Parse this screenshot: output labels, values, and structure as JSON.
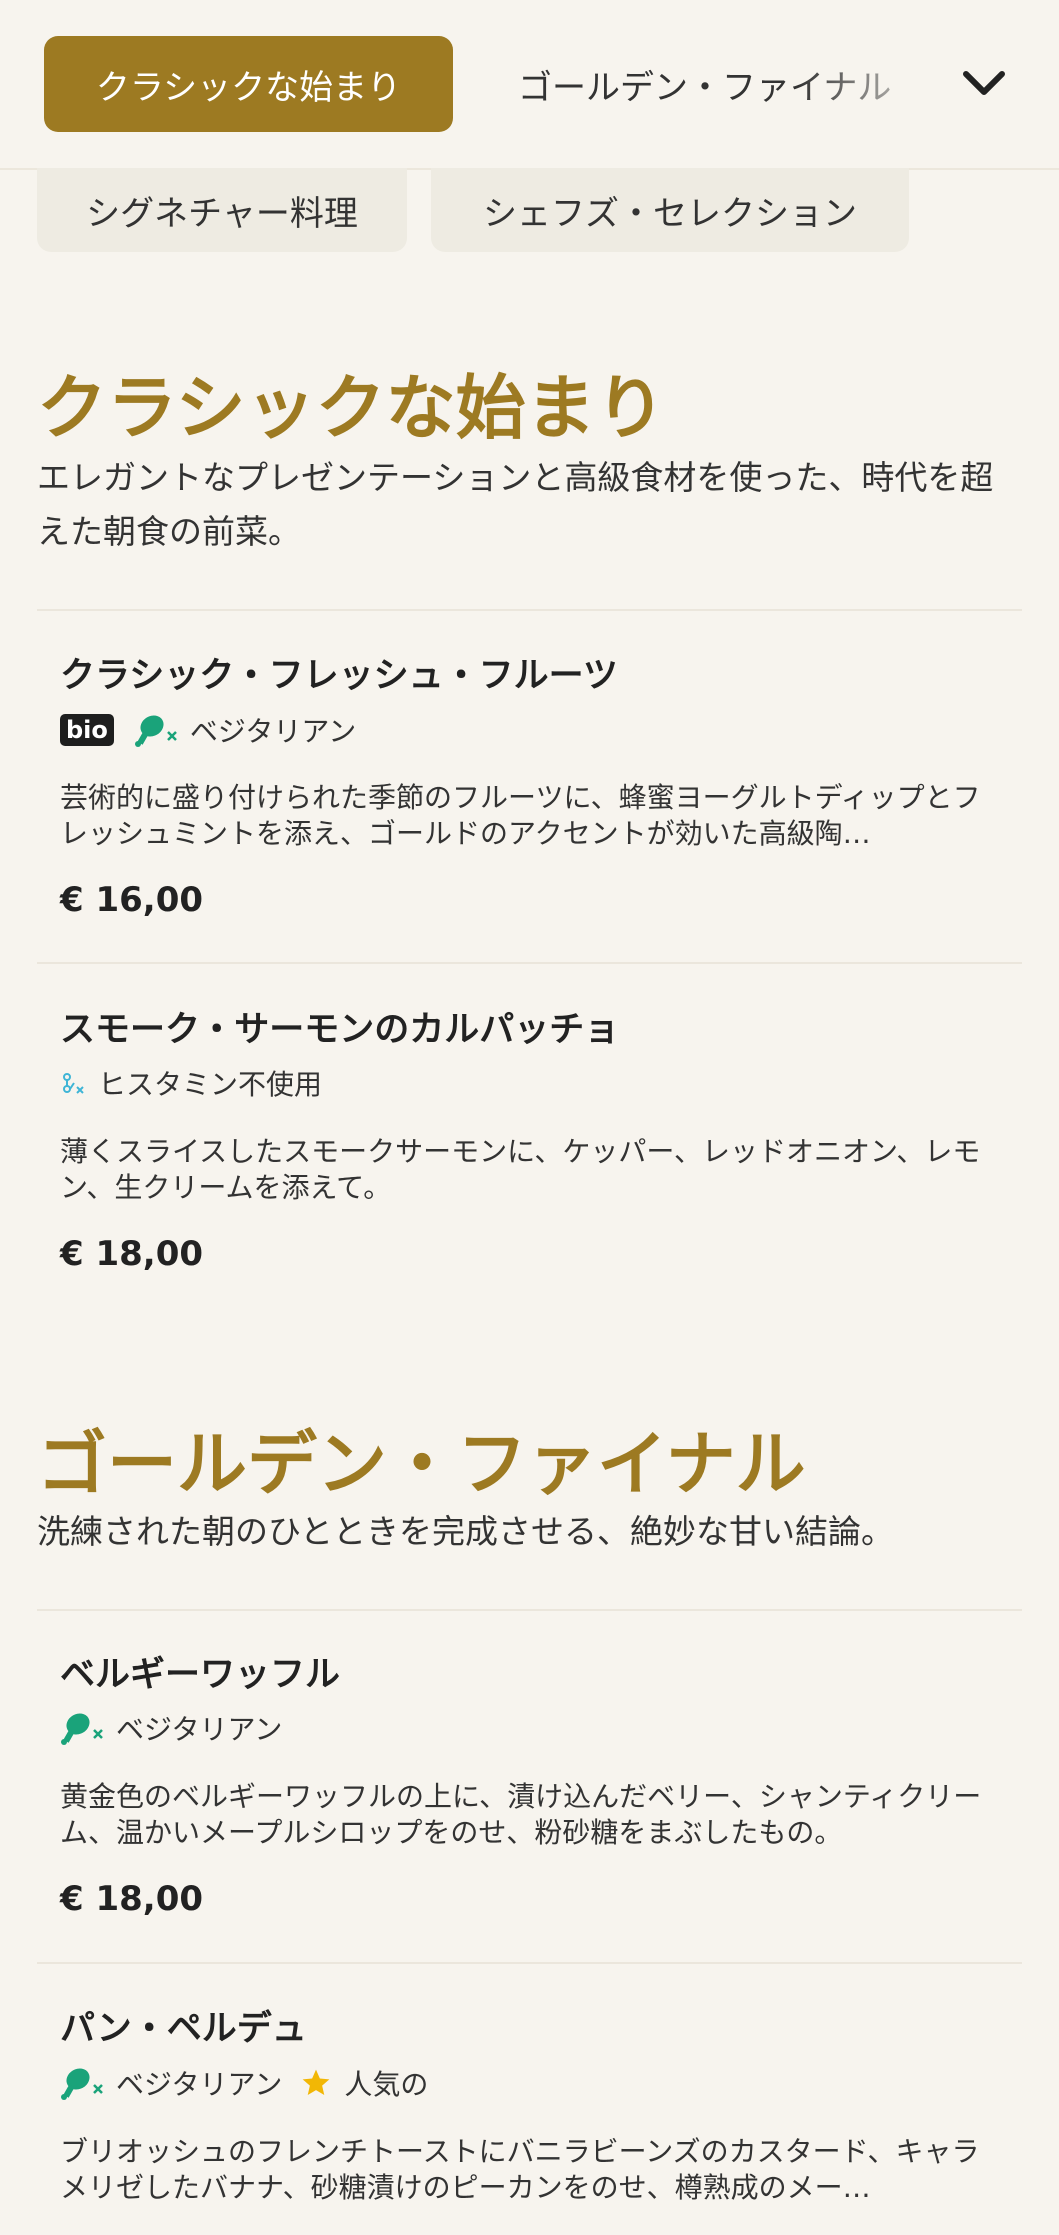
{
  "category_tabs": {
    "active": "クラシックな始まり",
    "next": "ゴールデン・ファイナル",
    "row2": [
      "シグネチャー料理",
      "シェフズ・セレクション"
    ]
  },
  "sections": [
    {
      "title": "クラシックな始まり",
      "description": "エレガントなプレゼンテーションと高級食材を使った、時代を超えた朝食の前菜。",
      "items": [
        {
          "name": "クラシック・フレッシュ・フルーツ",
          "badge": "bio",
          "tags": [
            "ベジタリアン"
          ],
          "description": "芸術的に盛り付けられた季節のフルーツに、蜂蜜ヨーグルトディップとフレッシュミントを添え、ゴールドのアクセントが効いた高級陶…",
          "price": "€ 16,00"
        },
        {
          "name": "スモーク・サーモンのカルパッチョ",
          "tags": [
            "ヒスタミン不使用"
          ],
          "description": "薄くスライスしたスモークサーモンに、ケッパー、レッドオニオン、レモン、生クリームを添えて。",
          "price": "€ 18,00"
        }
      ]
    },
    {
      "title": "ゴールデン・ファイナル",
      "description": "洗練された朝のひとときを完成させる、絶妙な甘い結論。",
      "items": [
        {
          "name": "ベルギーワッフル",
          "tags": [
            "ベジタリアン"
          ],
          "description": "黄金色のベルギーワッフルの上に、漬け込んだベリー、シャンティクリーム、温かいメープルシロップをのせ、粉砂糖をまぶしたもの。",
          "price": "€ 18,00"
        },
        {
          "name": "パン・ペルデュ",
          "tags": [
            "ベジタリアン",
            "人気の"
          ],
          "description": "ブリオッシュのフレンチトーストにバニラビーンズのカスタード、キャラメリゼしたバナナ、砂糖漬けのピーカンをのせ、樽熟成のメー…"
        }
      ]
    }
  ],
  "colors": {
    "accent": "#9d7a22",
    "background": "#f7f4ee",
    "veg_icon": "#1aa37a",
    "histamine_icon": "#3fb5d6",
    "star": "#f2b705"
  },
  "icons": {
    "vegetarian": "drumstick-crossed-icon",
    "histamine_free": "histamine-free-icon",
    "popular": "star-icon",
    "menu": "chevron-down-icon"
  }
}
